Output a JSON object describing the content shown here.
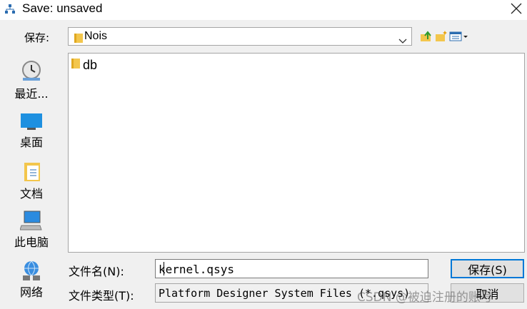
{
  "window": {
    "title": "Save: unsaved"
  },
  "save_in": {
    "label": "保存:",
    "value": "Nois"
  },
  "places": [
    {
      "label": "最近..."
    },
    {
      "label": "桌面"
    },
    {
      "label": "文档"
    },
    {
      "label": "此电脑"
    },
    {
      "label": "网络"
    }
  ],
  "files": [
    {
      "name": "db",
      "type": "folder"
    }
  ],
  "filename": {
    "label": "文件名(N):",
    "value": "kernel.qsys"
  },
  "filetype": {
    "label": "文件类型(T):",
    "value": "Platform Designer System Files (*.qsys)"
  },
  "buttons": {
    "save": "保存(S)",
    "cancel": "取消"
  },
  "watermark": "CSDN @被迫注册的账号",
  "colors": {
    "accent": "#0078d7",
    "folder": "#f3c64c"
  }
}
